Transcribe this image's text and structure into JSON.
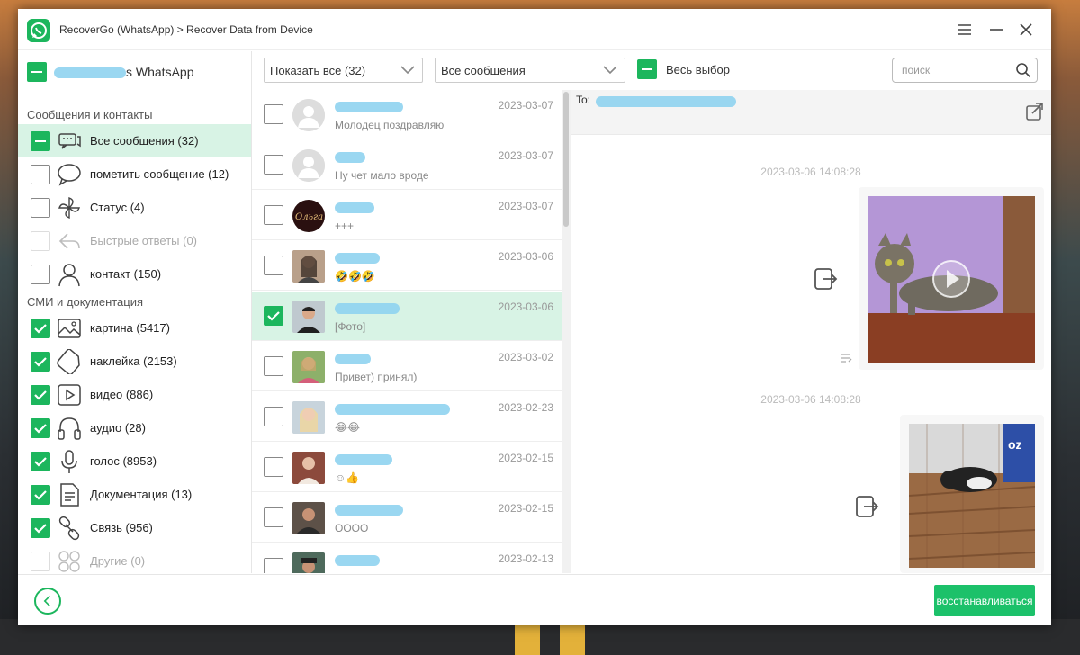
{
  "window": {
    "title": "RecoverGo (WhatsApp) > Recover Data from Device"
  },
  "account": {
    "name_suffix": "s WhatsApp"
  },
  "sections": {
    "messages_title": "Сообщения и контакты",
    "media_title": "СМИ и документация"
  },
  "categories": [
    {
      "label": "Все сообщения  (32)",
      "icon": "chat-icon",
      "state": "partial",
      "active": true
    },
    {
      "label": "пометить сообщение  (12)",
      "icon": "speech-bubble-icon",
      "state": "unchecked"
    },
    {
      "label": "Статус  (4)",
      "icon": "pinwheel-icon",
      "state": "unchecked"
    },
    {
      "label": "Быстрые ответы  (0)",
      "icon": "reply-icon",
      "state": "disabled"
    },
    {
      "label": "контакт  (150)",
      "icon": "person-icon",
      "state": "unchecked"
    },
    {
      "label": "картина  (5417)",
      "icon": "image-icon",
      "state": "checked"
    },
    {
      "label": "наклейка  (2153)",
      "icon": "sticker-icon",
      "state": "checked"
    },
    {
      "label": "видео  (886)",
      "icon": "video-icon",
      "state": "checked"
    },
    {
      "label": "аудио  (28)",
      "icon": "headphones-icon",
      "state": "checked"
    },
    {
      "label": "голос  (8953)",
      "icon": "microphone-icon",
      "state": "checked"
    },
    {
      "label": "Документация  (13)",
      "icon": "document-icon",
      "state": "checked"
    },
    {
      "label": "Связь  (956)",
      "icon": "link-icon",
      "state": "checked"
    },
    {
      "label": "Другие  (0)",
      "icon": "grid-icon",
      "state": "disabled"
    }
  ],
  "toolbar": {
    "show_filter": "Показать все (32)",
    "message_filter": "Все сообщения",
    "select_all": "Весь выбор",
    "search_placeholder": "поиск"
  },
  "chats": [
    {
      "date": "2023-03-07",
      "preview": "Молодец поздравляю",
      "name_visible": "",
      "avatar": "default",
      "checked": false
    },
    {
      "date": "2023-03-07",
      "preview": "Ну чет мало вроде",
      "name_visible": "",
      "avatar": "default",
      "checked": false
    },
    {
      "date": "2023-03-07",
      "preview": "+++",
      "name_visible": "Ольга",
      "avatar": "olga",
      "checked": false
    },
    {
      "date": "2023-03-06",
      "preview": "🤣🤣🤣",
      "name_visible": "",
      "avatar": "photo-woman-dark",
      "checked": false
    },
    {
      "date": "2023-03-06",
      "preview": "[Фото]",
      "name_visible": "",
      "avatar": "photo-man",
      "checked": true,
      "active": true
    },
    {
      "date": "2023-03-02",
      "preview": "Привет) принял)",
      "name_visible": "",
      "avatar": "photo-woman-green",
      "checked": false
    },
    {
      "date": "2023-02-23",
      "preview": "😂😂",
      "name_visible": "",
      "avatar": "photo-woman-blonde",
      "checked": false
    },
    {
      "date": "2023-02-15",
      "preview": "☺👍",
      "name_visible": "",
      "avatar": "photo-woman-red",
      "checked": false
    },
    {
      "date": "2023-02-15",
      "preview": "OOOO",
      "name_visible": "",
      "avatar": "photo-man-dark",
      "checked": false
    },
    {
      "date": "2023-02-13",
      "preview": "😂😂😂😂😂😂",
      "name_visible": "",
      "avatar": "photo-man-hat",
      "checked": false
    }
  ],
  "conversation": {
    "to_label": "To:",
    "messages": [
      {
        "timestamp": "2023-03-06 14:08:28",
        "type": "video",
        "content": "cat-on-purple-background"
      },
      {
        "timestamp": "2023-03-06 14:08:28",
        "type": "image",
        "content": "cat-on-wooden-floor"
      }
    ]
  },
  "footer": {
    "recover_label": "восстанавливаться"
  },
  "colors": {
    "accent": "#1cb65d",
    "active_row": "#d8f3e5",
    "blur": "#8fd3f0"
  }
}
